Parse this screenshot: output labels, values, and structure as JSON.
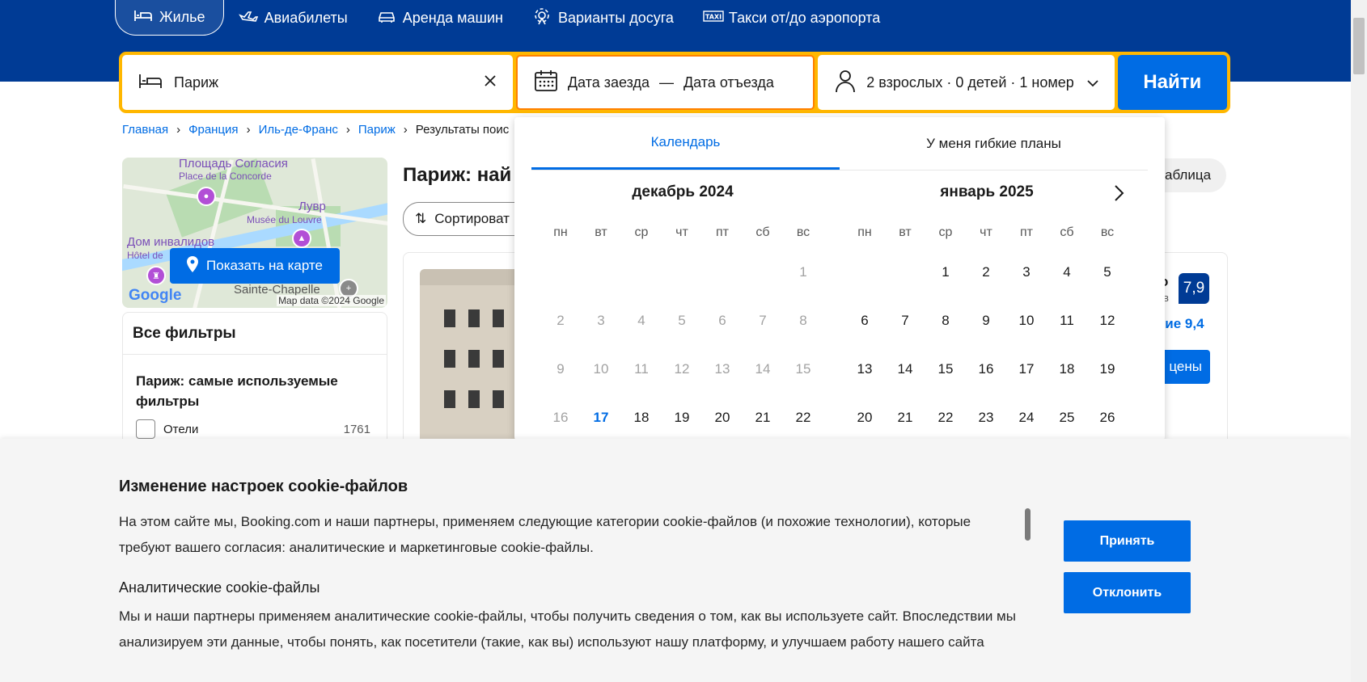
{
  "nav": {
    "items": [
      {
        "label": "Жилье",
        "icon": "bed-icon"
      },
      {
        "label": "Авиабилеты",
        "icon": "plane-icon"
      },
      {
        "label": "Аренда машин",
        "icon": "car-icon"
      },
      {
        "label": "Варианты досуга",
        "icon": "attractions-icon"
      },
      {
        "label": "Такси от/до аэропорта",
        "icon": "taxi-icon"
      }
    ]
  },
  "search": {
    "destination": "Париж",
    "checkin": "Дата заезда",
    "dash": "—",
    "checkout": "Дата отъезда",
    "guests": "2 взрослых · 0 детей · 1 номер",
    "find_label": "Найти"
  },
  "breadcrumb": [
    "Главная",
    "Франция",
    "Иль-де-Франс",
    "Париж",
    "Результаты поис"
  ],
  "map": {
    "labels": {
      "concorde_ru": "Площадь Согласия",
      "concorde_fr": "Place de la Concorde",
      "louvre_ru": "Лувр",
      "louvre_fr": "Musée du Louvre",
      "invalides_ru": "Дом инвалидов",
      "invalides_fr": "Hôtel de",
      "chapelle": "Sainte-Chapelle"
    },
    "show_button": "Показать на карте",
    "google": "Google",
    "attribution": "Map data ©2024 Google"
  },
  "filters": {
    "header": "Все фильтры",
    "section_title": "Париж: самые используемые фильтры",
    "items": [
      {
        "label": "Отели",
        "count": "1761"
      }
    ]
  },
  "results": {
    "title": "Париж: най",
    "sort_label": "Сортироват",
    "table_label": "аблица",
    "rating_partial": "о",
    "reviews_partial": "в",
    "score": "7,9",
    "location_partial": "ние 9,4",
    "prices_partial": "цены"
  },
  "calendar": {
    "tabs": [
      "Календарь",
      "У меня гибкие планы"
    ],
    "weekdays": [
      "пн",
      "вт",
      "ср",
      "чт",
      "пт",
      "сб",
      "вс"
    ],
    "months": [
      {
        "title": "декабрь 2024",
        "offset": 6,
        "days": [
          1,
          2,
          3,
          4,
          5,
          6,
          7,
          8,
          9,
          10,
          11,
          12,
          13,
          14,
          15,
          16,
          17,
          18,
          19,
          20,
          21,
          22
        ],
        "past_until": 16,
        "today": 17
      },
      {
        "title": "январь 2025",
        "offset": 2,
        "days": [
          1,
          2,
          3,
          4,
          5,
          6,
          7,
          8,
          9,
          10,
          11,
          12,
          13,
          14,
          15,
          16,
          17,
          18,
          19,
          20,
          21,
          22,
          23,
          24,
          25,
          26
        ],
        "past_until": 0,
        "today": 0
      }
    ]
  },
  "cookie": {
    "title": "Изменение настроек cookie-файлов",
    "text": "На этом сайте мы, Booking.com и наши партнеры, применяем следующие категории cookie-файлов (и похожие технологии), которые требуют вашего согласия: аналитические и маркетинговые cookie-файлы.",
    "analytics_title": "Аналитические cookie-файлы",
    "analytics_text": "Мы и наши партнеры применяем аналитические cookie-файлы, чтобы получить сведения о том, как вы используете сайт. Впоследствии мы анализируем эти данные, чтобы понять, как посетители (такие, как вы) используют нашу платформу, и улучшаем работу нашего сайта",
    "accept": "Принять",
    "decline": "Отклонить"
  },
  "colors": {
    "brand_blue": "#003b95",
    "action_blue": "#006ce4",
    "search_border": "#ffb700"
  }
}
